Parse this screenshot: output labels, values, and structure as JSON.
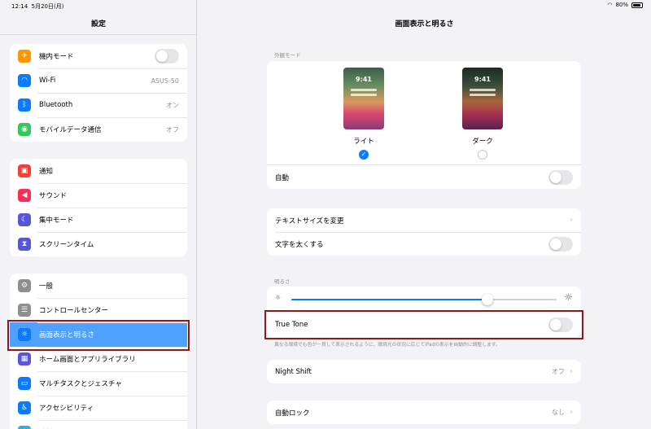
{
  "status": {
    "time": "12:14",
    "date": "5月20日(月)",
    "battery": "80%"
  },
  "sidebar": {
    "title": "設定",
    "groups": [
      {
        "items": [
          {
            "label": "機内モード",
            "icon": "airplane-icon",
            "color": "#ff9500",
            "type": "toggle"
          },
          {
            "label": "Wi-Fi",
            "icon": "wifi-icon",
            "color": "#0a7aff",
            "value": "ASUS-50"
          },
          {
            "label": "Bluetooth",
            "icon": "bluetooth-icon",
            "color": "#0a7aff",
            "value": "オン"
          },
          {
            "label": "モバイルデータ通信",
            "icon": "antenna-icon",
            "color": "#34c759",
            "value": "オフ"
          }
        ]
      },
      {
        "items": [
          {
            "label": "通知",
            "icon": "bell-icon",
            "color": "#ff3b30"
          },
          {
            "label": "サウンド",
            "icon": "speaker-icon",
            "color": "#ff2d55"
          },
          {
            "label": "集中モード",
            "icon": "moon-icon",
            "color": "#5856d6"
          },
          {
            "label": "スクリーンタイム",
            "icon": "hourglass-icon",
            "color": "#5856d6"
          }
        ]
      },
      {
        "items": [
          {
            "label": "一般",
            "icon": "gear-icon",
            "color": "#8e8e93"
          },
          {
            "label": "コントロールセンター",
            "icon": "switches-icon",
            "color": "#8e8e93"
          },
          {
            "label": "画面表示と明るさ",
            "icon": "sun-icon",
            "color": "#0a7aff",
            "selected": true
          },
          {
            "label": "ホーム画面とアプリライブラリ",
            "icon": "grid-icon",
            "color": "#5856d6"
          },
          {
            "label": "マルチタスクとジェスチャ",
            "icon": "multitask-icon",
            "color": "#0a7aff"
          },
          {
            "label": "アクセシビリティ",
            "icon": "accessibility-icon",
            "color": "#0a7aff"
          },
          {
            "label": "壁紙",
            "icon": "flower-icon",
            "color": "#32ade6"
          }
        ]
      }
    ]
  },
  "main": {
    "title": "画面表示と明るさ",
    "appearance_label": "外観モード",
    "light": {
      "clock": "9:41",
      "name": "ライト"
    },
    "dark": {
      "clock": "9:41",
      "name": "ダーク"
    },
    "auto_label": "自動",
    "text_size_label": "テキストサイズを変更",
    "bold_text_label": "文字を太くする",
    "brightness_label": "明るさ",
    "brightness_level": 0.74,
    "true_tone_label": "True Tone",
    "true_tone_footnote": "異なる環境でも色が一貫して表示されるように、環境光の状況に応じてiPadの表示を自動的に調整します。",
    "night_shift_label": "Night Shift",
    "night_shift_value": "オフ",
    "auto_lock_label": "自動ロック",
    "auto_lock_value": "なし"
  },
  "icons": {
    "chevron": "chevron-right-icon",
    "check": "checkmark-icon"
  }
}
